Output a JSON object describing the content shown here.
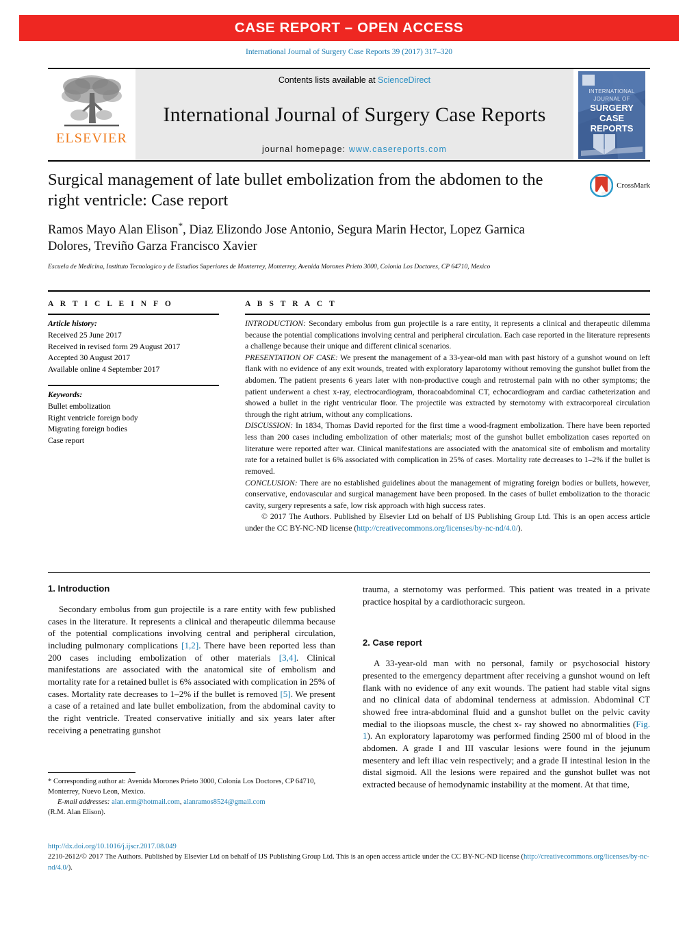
{
  "banner": {
    "text": "CASE REPORT – OPEN ACCESS"
  },
  "citation": {
    "text": "International Journal of Surgery Case Reports 39 (2017) 317–320"
  },
  "masthead": {
    "publisher": "ELSEVIER",
    "contents_prefix": "Contents lists available at ",
    "contents_link": "ScienceDirect",
    "journal_title": "International Journal of Surgery Case Reports",
    "homepage_label": "journal homepage: ",
    "homepage_url": "www.casereports.com",
    "cover_lines": [
      "INTERNATIONAL",
      "JOURNAL OF",
      "SURGERY",
      "CASE",
      "REPORTS"
    ]
  },
  "article": {
    "title": "Surgical management of late bullet embolization from the abdomen to the right ventricle: Case report",
    "authors": "Ramos Mayo Alan Elison",
    "authors_rest": ", Diaz Elizondo Jose Antonio, Segura Marin Hector, Lopez Garnica Dolores, Treviño Garza Francisco Xavier",
    "affiliation": "Escuela de Medicina, Instituto Tecnologico y de Estudios Superiores de Monterrey, Monterrey, Avenida Morones Prieto 3000, Colonia Los Doctores, CP 64710, Mexico",
    "crossmark_label": "CrossMark"
  },
  "info": {
    "heading": "A R T I C L E   I N F O",
    "history_label": "Article history:",
    "history": [
      "Received 25 June 2017",
      "Received in revised form 29 August 2017",
      "Accepted 30 August 2017",
      "Available online 4 September 2017"
    ],
    "keywords_label": "Keywords:",
    "keywords": [
      "Bullet embolization",
      "Right ventricle foreign body",
      "Migrating foreign bodies",
      "Case report"
    ]
  },
  "abstract": {
    "heading": "A B S T R A C T",
    "sections": [
      {
        "label": "INTRODUCTION:",
        "text": " Secondary embolus from gun projectile is a rare entity, it represents a clinical and therapeutic dilemma because the potential complications involving central and peripheral circulation. Each case reported in the literature represents a challenge because their unique and different clinical scenarios."
      },
      {
        "label": "PRESENTATION OF CASE:",
        "text": " We present the management of a 33-year-old man with past history of a gunshot wound on left flank with no evidence of any exit wounds, treated with exploratory laparotomy without removing the gunshot bullet from the abdomen. The patient presents 6 years later with non-productive cough and retrosternal pain with no other symptoms; the patient underwent a chest x-ray, electrocardiogram, thoracoabdominal CT, echocardiogram and cardiac catheterization and showed a bullet in the right ventricular floor. The projectile was extracted by sternotomy with extracorporeal circulation through the right atrium, without any complications."
      },
      {
        "label": "DISCUSSION:",
        "text": " In 1834, Thomas David reported for the first time a wood-fragment embolization. There have been reported less than 200 cases including embolization of other materials; most of the gunshot bullet embolization cases reported on literature were reported after war. Clinical manifestations are associated with the anatomical site of embolism and mortality rate for a retained bullet is 6% associated with complication in 25% of cases. Mortality rate decreases to 1–2% if the bullet is removed."
      },
      {
        "label": "CONCLUSION:",
        "text": " There are no established guidelines about the management of migrating foreign bodies or bullets, however, conservative, endovascular and surgical management have been proposed. In the cases of bullet embolization to the thoracic cavity, surgery represents a safe, low risk approach with high success rates."
      }
    ],
    "copyright_text": "© 2017 The Authors. Published by Elsevier Ltd on behalf of IJS Publishing Group Ltd. This is an open access article under the CC BY-NC-ND license (",
    "copyright_link": "http://creativecommons.org/licenses/by-nc-nd/4.0/",
    "copyright_tail": ")."
  },
  "body": {
    "intro_heading": "1.  Introduction",
    "intro_p1_a": "Secondary embolus from gun projectile is a rare entity with few published cases in the literature. It represents a clinical and therapeutic dilemma because of the potential complications involving central and peripheral circulation, including pulmonary complications ",
    "intro_ref1": "[1,2]",
    "intro_p1_b": ". There have been reported less than 200 cases including embolization of other materials ",
    "intro_ref2": "[3,4]",
    "intro_p1_c": ". Clinical manifestations are associated with the anatomical site of embolism and mortality rate for a retained bullet is 6% associated with complication in 25% of cases. Mortality rate decreases to 1–2% if the bullet is removed ",
    "intro_ref3": "[5]",
    "intro_p1_d": ". We present a case of a retained and late bullet embolization, from the abdominal cavity to the right ventricle. Treated conservative initially and six years later after receiving a penetrating gunshot",
    "intro_cont": "trauma, a sternotomy was performed. This patient was treated in a private practice hospital by a cardiothoracic surgeon.",
    "case_heading": "2.  Case report",
    "case_p1_a": "A 33-year-old man with no personal, family or psychosocial history presented to the emergency department after receiving a gunshot wound on left flank with no evidence of any exit wounds. The patient had stable vital signs and no clinical data of abdominal tenderness at admission. Abdominal CT showed free intra-abdominal fluid and a gunshot bullet on the pelvic cavity medial to the iliopsoas muscle, the chest x- ray showed no abnormalities (",
    "case_figref": "Fig. 1",
    "case_p1_b": "). An exploratory laparotomy was performed finding 2500 ml of blood in the abdomen. A grade I and III vascular lesions were found in the jejunum mesentery and left iliac vein respectively; and a grade II intestinal lesion in the distal sigmoid. All the lesions were repaired and the gunshot bullet was not extracted because of hemodynamic instability at the moment. At that time,"
  },
  "footnotes": {
    "corresponding": "*  Corresponding author at: Avenida Morones Prieto 3000, Colonia Los Doctores, CP 64710, Monterrey, Nuevo Leon, Mexico.",
    "email_label": "E-mail addresses:",
    "email1": "alan.erm@hotmail.com",
    "email_sep": ", ",
    "email2": "alanramos8524@gmail.com",
    "email_tail": "(R.M. Alan Elison)."
  },
  "bottom": {
    "doi": "http://dx.doi.org/10.1016/j.ijscr.2017.08.049",
    "issn_text": "2210-2612/© 2017 The Authors. Published by Elsevier Ltd on behalf of IJS Publishing Group Ltd. This is an open access article under the CC BY-NC-ND license (",
    "license_link": "http://creativecommons.org/licenses/by-nc-nd/4.0/",
    "license_tail": ")."
  },
  "colors": {
    "banner_red": "#ee2722",
    "link_blue": "#1a7bb0",
    "elsevier_orange": "#f07c1e",
    "masthead_grey": "#e9e9e9"
  }
}
